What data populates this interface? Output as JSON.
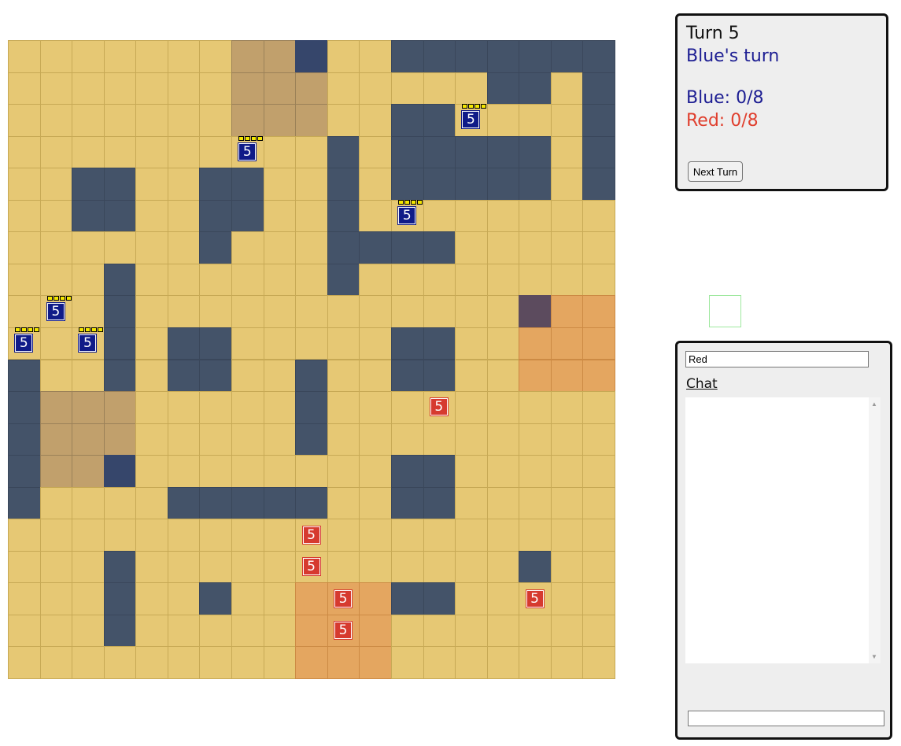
{
  "status": {
    "turn_label": "Turn 5",
    "turn_owner": "Blue's turn",
    "blue_score": "Blue: 0/8",
    "red_score": "Red: 0/8",
    "next_turn_label": "Next Turn"
  },
  "colors": {
    "blue_text": "#1d1e93",
    "red_text": "#e0402f",
    "tile": "#e6c874",
    "wall": "#445369",
    "blue_base": "#c1a06c",
    "red_zone": "#e4a660"
  },
  "chat": {
    "player_name": "Red",
    "heading": "Chat",
    "messages": [],
    "input_value": ""
  },
  "board": {
    "cols": 19,
    "rows": 20,
    "walls": [
      [
        0,
        12
      ],
      [
        0,
        13
      ],
      [
        0,
        14
      ],
      [
        0,
        15
      ],
      [
        0,
        16
      ],
      [
        0,
        17
      ],
      [
        0,
        18
      ],
      [
        1,
        15
      ],
      [
        1,
        16
      ],
      [
        1,
        18
      ],
      [
        2,
        12
      ],
      [
        2,
        13
      ],
      [
        2,
        18
      ],
      [
        3,
        10
      ],
      [
        3,
        12
      ],
      [
        3,
        13
      ],
      [
        3,
        14
      ],
      [
        3,
        15
      ],
      [
        3,
        16
      ],
      [
        3,
        18
      ],
      [
        4,
        2
      ],
      [
        4,
        3
      ],
      [
        4,
        6
      ],
      [
        4,
        7
      ],
      [
        4,
        10
      ],
      [
        4,
        12
      ],
      [
        4,
        13
      ],
      [
        4,
        14
      ],
      [
        4,
        15
      ],
      [
        4,
        16
      ],
      [
        4,
        18
      ],
      [
        5,
        2
      ],
      [
        5,
        3
      ],
      [
        5,
        6
      ],
      [
        5,
        7
      ],
      [
        5,
        10
      ],
      [
        6,
        6
      ],
      [
        6,
        10
      ],
      [
        6,
        11
      ],
      [
        6,
        12
      ],
      [
        6,
        13
      ],
      [
        7,
        3
      ],
      [
        7,
        10
      ],
      [
        8,
        3
      ],
      [
        9,
        3
      ],
      [
        9,
        5
      ],
      [
        9,
        6
      ],
      [
        9,
        12
      ],
      [
        9,
        13
      ],
      [
        10,
        0
      ],
      [
        10,
        3
      ],
      [
        10,
        5
      ],
      [
        10,
        6
      ],
      [
        10,
        9
      ],
      [
        10,
        12
      ],
      [
        10,
        13
      ],
      [
        11,
        0
      ],
      [
        11,
        9
      ],
      [
        12,
        0
      ],
      [
        12,
        9
      ],
      [
        13,
        0
      ],
      [
        13,
        12
      ],
      [
        13,
        13
      ],
      [
        14,
        0
      ],
      [
        14,
        5
      ],
      [
        14,
        6
      ],
      [
        14,
        7
      ],
      [
        14,
        8
      ],
      [
        14,
        9
      ],
      [
        14,
        12
      ],
      [
        14,
        13
      ],
      [
        16,
        3
      ],
      [
        16,
        16
      ],
      [
        17,
        3
      ],
      [
        17,
        6
      ],
      [
        17,
        12
      ],
      [
        17,
        13
      ],
      [
        18,
        3
      ]
    ],
    "wall_bases": [
      [
        0,
        9
      ],
      [
        13,
        3
      ]
    ],
    "blue_base_tiles": [
      [
        0,
        7
      ],
      [
        0,
        8
      ],
      [
        1,
        7
      ],
      [
        1,
        8
      ],
      [
        1,
        9
      ],
      [
        2,
        7
      ],
      [
        2,
        8
      ],
      [
        2,
        9
      ],
      [
        11,
        1
      ],
      [
        11,
        2
      ],
      [
        11,
        3
      ],
      [
        12,
        1
      ],
      [
        12,
        2
      ],
      [
        12,
        3
      ],
      [
        13,
        1
      ],
      [
        13,
        2
      ]
    ],
    "red_zone_tiles": [
      [
        8,
        17
      ],
      [
        8,
        18
      ],
      [
        9,
        16
      ],
      [
        9,
        17
      ],
      [
        9,
        18
      ],
      [
        10,
        16
      ],
      [
        10,
        17
      ],
      [
        10,
        18
      ],
      [
        17,
        9
      ],
      [
        17,
        10
      ],
      [
        17,
        11
      ],
      [
        18,
        9
      ],
      [
        18,
        10
      ],
      [
        18,
        11
      ],
      [
        19,
        9
      ],
      [
        19,
        10
      ],
      [
        19,
        11
      ]
    ],
    "red_zone_walls": [
      [
        8,
        16
      ]
    ]
  },
  "units": [
    {
      "team": "blue",
      "value": "5",
      "row": 2,
      "col": 14,
      "pips": 4
    },
    {
      "team": "blue",
      "value": "5",
      "row": 3,
      "col": 7,
      "pips": 4
    },
    {
      "team": "blue",
      "value": "5",
      "row": 5,
      "col": 12,
      "pips": 4
    },
    {
      "team": "blue",
      "value": "5",
      "row": 8,
      "col": 1,
      "pips": 4
    },
    {
      "team": "blue",
      "value": "5",
      "row": 9,
      "col": 0,
      "pips": 4
    },
    {
      "team": "blue",
      "value": "5",
      "row": 9,
      "col": 2,
      "pips": 4
    },
    {
      "team": "red",
      "value": "5",
      "row": 11,
      "col": 13,
      "pips": 0
    },
    {
      "team": "red",
      "value": "5",
      "row": 15,
      "col": 9,
      "pips": 0
    },
    {
      "team": "red",
      "value": "5",
      "row": 16,
      "col": 9,
      "pips": 0
    },
    {
      "team": "red",
      "value": "5",
      "row": 17,
      "col": 10,
      "pips": 0
    },
    {
      "team": "red",
      "value": "5",
      "row": 17,
      "col": 16,
      "pips": 0
    },
    {
      "team": "red",
      "value": "5",
      "row": 18,
      "col": 10,
      "pips": 0
    }
  ]
}
